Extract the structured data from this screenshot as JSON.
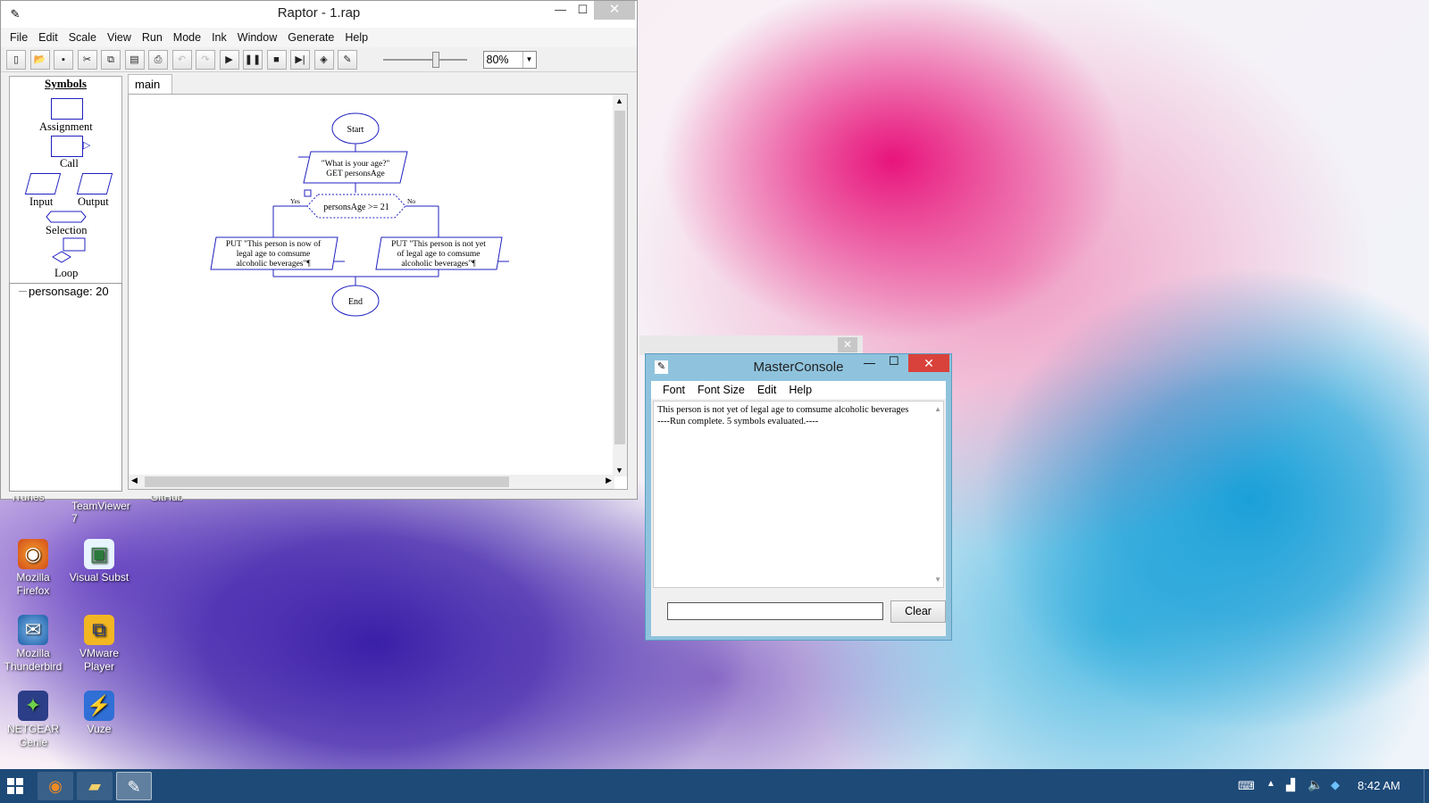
{
  "raptor": {
    "title": "Raptor - 1.rap",
    "menu": [
      "File",
      "Edit",
      "Scale",
      "View",
      "Run",
      "Mode",
      "Ink",
      "Window",
      "Generate",
      "Help"
    ],
    "zoom": "80%",
    "symbols_title": "Symbols",
    "symbols": {
      "assignment": "Assignment",
      "call": "Call",
      "input": "Input",
      "output": "Output",
      "selection": "Selection",
      "loop": "Loop"
    },
    "watch": "personsage: 20",
    "tab": "main",
    "flowchart": {
      "start": "Start",
      "input_line1": "\"What is your age?\"",
      "input_line2": "GET personsAge",
      "condition": "personsAge >= 21",
      "yes": "Yes",
      "no": "No",
      "out_left": [
        "PUT \"This person is now of",
        "legal age to comsume",
        "alcoholic beverages\"¶"
      ],
      "out_right": [
        "PUT \"This person is not yet",
        "of legal age to comsume",
        "alcoholic beverages\"¶"
      ],
      "end": "End"
    }
  },
  "master_console": {
    "title": "MasterConsole",
    "menu": [
      "Font",
      "Font Size",
      "Edit",
      "Help"
    ],
    "output_lines": [
      "This person is not yet of legal age to comsume alcoholic beverages",
      "----Run complete.  5 symbols evaluated.----"
    ],
    "clear_label": "Clear"
  },
  "desktop": {
    "icons": [
      {
        "label": "Mozilla Firefox",
        "icon": "firefox-icon"
      },
      {
        "label": "Visual Subst",
        "icon": "visual-subst-icon"
      },
      {
        "label": "Mozilla Thunderbird",
        "icon": "thunderbird-icon"
      },
      {
        "label": "VMware Player",
        "icon": "vmware-icon"
      },
      {
        "label": "NETGEAR Genie",
        "icon": "netgear-icon"
      },
      {
        "label": "Vuze",
        "icon": "vuze-icon"
      }
    ],
    "partial_labels": [
      "iTunes",
      "TeamViewer 7",
      "GitHub"
    ]
  },
  "taskbar": {
    "clock": "8:42 AM"
  }
}
